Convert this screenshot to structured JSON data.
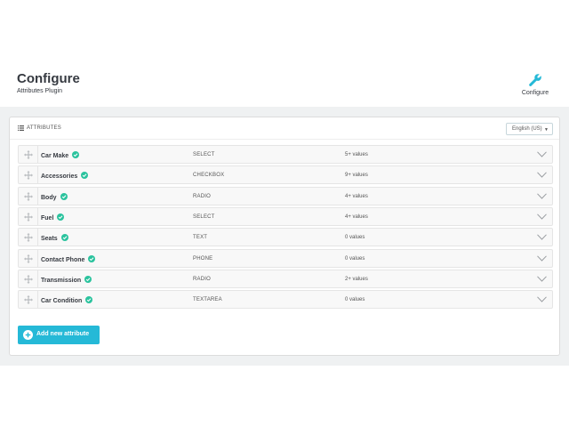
{
  "header": {
    "title": "Configure",
    "subtitle": "Attributes Plugin",
    "configure_label": "Configure"
  },
  "panel": {
    "title": "ATTRIBUTES",
    "language": "English (US)"
  },
  "attributes": [
    {
      "name": "Car Make",
      "type": "SELECT",
      "values": "5+ values",
      "enabled": true
    },
    {
      "name": "Accessories",
      "type": "CHECKBOX",
      "values": "9+ values",
      "enabled": true
    },
    {
      "name": "Body",
      "type": "RADIO",
      "values": "4+ values",
      "enabled": true
    },
    {
      "name": "Fuel",
      "type": "SELECT",
      "values": "4+ values",
      "enabled": true
    },
    {
      "name": "Seats",
      "type": "TEXT",
      "values": "0 values",
      "enabled": true
    },
    {
      "name": "Contact Phone",
      "type": "PHONE",
      "values": "0 values",
      "enabled": true
    },
    {
      "name": "Transmission",
      "type": "RADIO",
      "values": "2+ values",
      "enabled": true
    },
    {
      "name": "Car Condition",
      "type": "TEXTAREA",
      "values": "0 values",
      "enabled": true
    }
  ],
  "add_button": {
    "label": "Add new attribute"
  },
  "colors": {
    "accent": "#25b9d7",
    "check": "#2bc39e",
    "background": "#eff1f2"
  },
  "icons": {
    "configure": "wrench-icon",
    "list": "list-icon",
    "drag": "drag-handle-icon",
    "status": "check-circle-icon",
    "expand": "chevron-down-icon",
    "add": "plus-circle-icon"
  }
}
